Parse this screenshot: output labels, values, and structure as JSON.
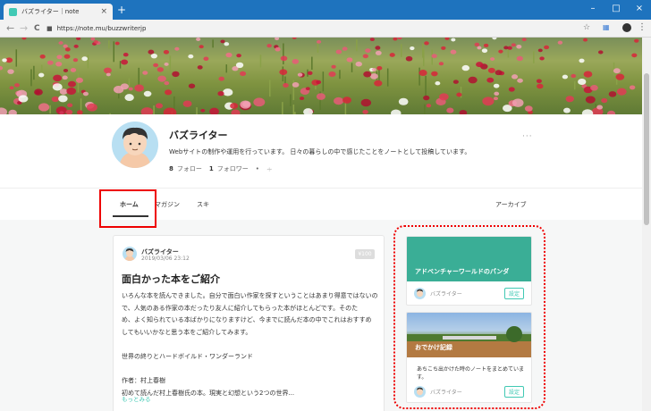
{
  "browser": {
    "tab_title": "バズライター｜note",
    "tab_close": "×",
    "new_tab": "+",
    "win_min": "–",
    "win_max": "□",
    "win_close": "×",
    "url": "https://note.mu/buzzwriterjp",
    "back": "←",
    "forward": "→",
    "reload": "C",
    "menu": "⋮"
  },
  "profile": {
    "name": "バズライター",
    "description": "Webサイトの制作や運用を行っています。 日々の暮らしの中で感じたことをノートとして投稿しています。",
    "follow_count": "8",
    "follow_label": "フォロー",
    "follower_count": "1",
    "follower_label": "フォロワー",
    "more": "···"
  },
  "tabs": {
    "home": "ホーム",
    "magazine": "マガジン",
    "suki": "スキ",
    "archive": "アーカイブ"
  },
  "article": {
    "author": "バズライター",
    "date": "2019/03/06 23:12",
    "price": "¥100",
    "title": "面白かった本をご紹介",
    "body": [
      "いろんな本を読んできました。自分で面白い作家を探すということはあまり得意ではないの",
      "で、人気のある作家の本だったり友人に紹介してもらった本がほとんどです。そのた",
      "め、よく知られている本ばかりになりますけど、今までに読んだ本の中でこれはおすすめ",
      "してもいいかなと思う本をご紹介してみます。",
      "",
      "世界の終りとハードボイルド・ワンダーランド",
      "",
      "作者：村上春樹",
      "初めて読んだ村上春樹氏の本。現実と幻想という2つの世界..."
    ],
    "more": "もっとみる"
  },
  "magazines": [
    {
      "title": "アドベンチャーワールドのパンダ",
      "description": "",
      "author": "バズライター",
      "button": "設定"
    },
    {
      "title": "おでかけ記録",
      "description": "あちこち出かけた時のノートをまとめています。",
      "author": "バズライター",
      "button": "設定"
    }
  ],
  "colors": {
    "accent": "#41c9b4",
    "chrome_blue": "#1e73be",
    "highlight_red": "#ee0000",
    "magazine1_cover": "#3aae96"
  }
}
